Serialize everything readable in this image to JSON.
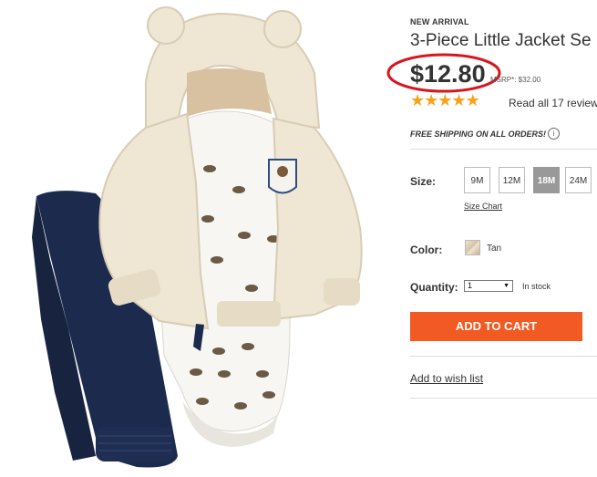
{
  "product": {
    "badge": "NEW ARRIVAL",
    "title": "3-Piece Little Jacket Se",
    "price": "$12.80",
    "msrp": "MSRP*: $32.00",
    "rating": 5,
    "reviews_link": "Read all 17 review"
  },
  "shipping": {
    "text": "FREE SHIPPING ON ALL ORDERS!",
    "info_glyph": "i"
  },
  "size": {
    "label": "Size:",
    "options": [
      "9M",
      "12M",
      "18M",
      "24M"
    ],
    "selected": "18M",
    "chart_link": "Size Chart"
  },
  "color": {
    "label": "Color:",
    "value": "Tan"
  },
  "quantity": {
    "label": "Quantity:",
    "value": "1",
    "stock": "In stock"
  },
  "actions": {
    "add_to_cart": "ADD TO CART",
    "wishlist": "Add to wish list"
  },
  "colors": {
    "price_highlight": "#d7161e",
    "button": "#f15a22",
    "star": "#f7a21b",
    "selected_size": "#999999"
  }
}
